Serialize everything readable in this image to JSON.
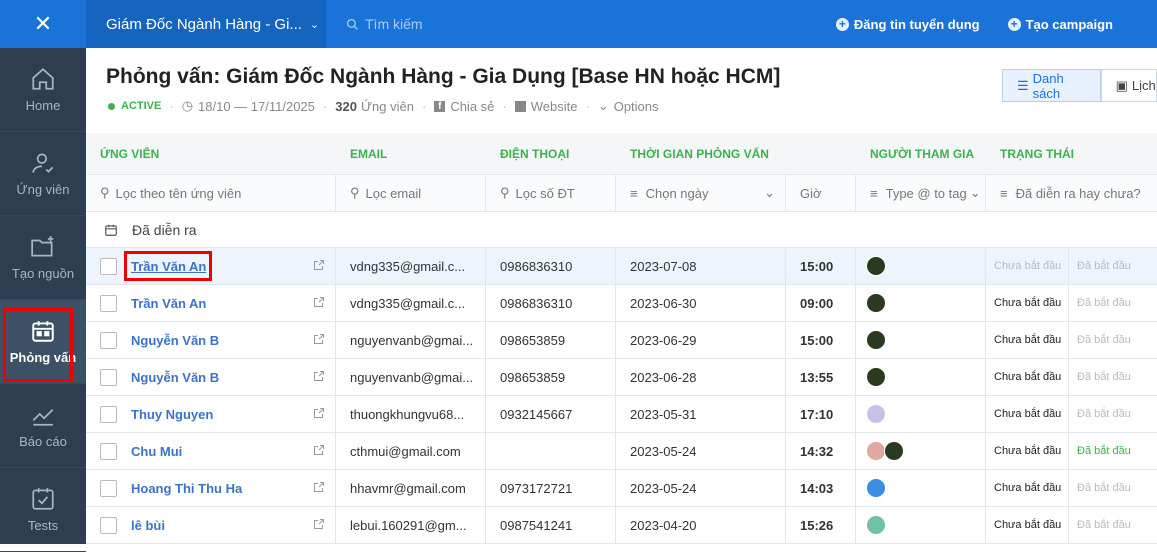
{
  "sidebar": {
    "close_icon": "close-icon",
    "items": [
      {
        "label": "Home",
        "icon": "home-icon"
      },
      {
        "label": "Ứng viên",
        "icon": "user-icon"
      },
      {
        "label": "Tạo nguồn",
        "icon": "folder-icon"
      },
      {
        "label": "Phỏng vấn",
        "icon": "calendar-icon"
      },
      {
        "label": "Báo cáo",
        "icon": "chart-icon"
      },
      {
        "label": "Tests",
        "icon": "test-icon"
      }
    ]
  },
  "topbar": {
    "project": "Giám Đốc Ngành Hàng - Gi...",
    "search_placeholder": "Tìm kiếm",
    "post_job": "Đăng tin tuyển dụng",
    "create_campaign": "Tạo campaign"
  },
  "header": {
    "title": "Phỏng vấn: Giám Đốc Ngành Hàng - Gia Dụng [Base HN hoặc HCM]",
    "status": "ACTIVE",
    "dates": "18/10 — 17/11/2025",
    "count": "320",
    "count_label": "Ứng viên",
    "share": "Chia sẻ",
    "website": "Website",
    "options": "Options",
    "view_list": "Danh sách",
    "view_calendar": "Lịch"
  },
  "table": {
    "columns": [
      "ỨNG VIÊN",
      "EMAIL",
      "ĐIỆN THOẠI",
      "THỜI GIAN PHỎNG VẤN",
      "NGƯỜI THAM GIA",
      "TRẠNG THÁI"
    ],
    "filters": {
      "name": "Lọc theo tên ứng viên",
      "email": "Lọc email",
      "phone": "Lọc số ĐT",
      "date": "Chọn ngày",
      "time": "Giờ",
      "type": "Type @ to tag",
      "status": "Đã diễn ra hay chưa?"
    },
    "group": "Đã diễn ra",
    "rows": [
      {
        "name": "Trần Văn An",
        "email": "vdng335@gmail.c...",
        "phone": "0986836310",
        "date": "2023-07-08",
        "time": "15:00",
        "s1": "Chưa bắt đầu",
        "s2": "Đã bắt đầu"
      },
      {
        "name": "Trần Văn An",
        "email": "vdng335@gmail.c...",
        "phone": "0986836310",
        "date": "2023-06-30",
        "time": "09:00",
        "s1": "Chưa bắt đầu",
        "s2": "Đã bắt đầu"
      },
      {
        "name": "Nguyễn Văn B",
        "email": "nguyenvanb@gmai...",
        "phone": "098653859",
        "date": "2023-06-29",
        "time": "15:00",
        "s1": "Chưa bắt đầu",
        "s2": "Đã bắt đầu"
      },
      {
        "name": "Nguyễn Văn B",
        "email": "nguyenvanb@gmai...",
        "phone": "098653859",
        "date": "2023-06-28",
        "time": "13:55",
        "s1": "Chưa bắt đầu",
        "s2": "Đã bắt đầu"
      },
      {
        "name": "Thuy Nguyen",
        "email": "thuongkhungvu68...",
        "phone": "0932145667",
        "date": "2023-05-31",
        "time": "17:10",
        "s1": "Chưa bắt đầu",
        "s2": "Đã bắt đầu"
      },
      {
        "name": "Chu Mui",
        "email": "cthmui@gmail.com",
        "phone": "",
        "date": "2023-05-24",
        "time": "14:32",
        "s1": "Chưa bắt đầu",
        "s2": "Đã bắt đầu"
      },
      {
        "name": "Hoang Thi Thu Ha",
        "email": "hhavmr@gmail.com",
        "phone": "0973172721",
        "date": "2023-05-24",
        "time": "14:03",
        "s1": "Chưa bắt đầu",
        "s2": "Đã bắt đầu"
      },
      {
        "name": "lê bùi",
        "email": "lebui.160291@gm...",
        "phone": "0987541241",
        "date": "2023-04-20",
        "time": "15:26",
        "s1": "Chưa bắt đầu",
        "s2": "Đã bắt đầu"
      }
    ]
  },
  "colors": {
    "primary": "#1a73d9",
    "accent_green": "#3bb34a",
    "highlight": "#e00000"
  }
}
